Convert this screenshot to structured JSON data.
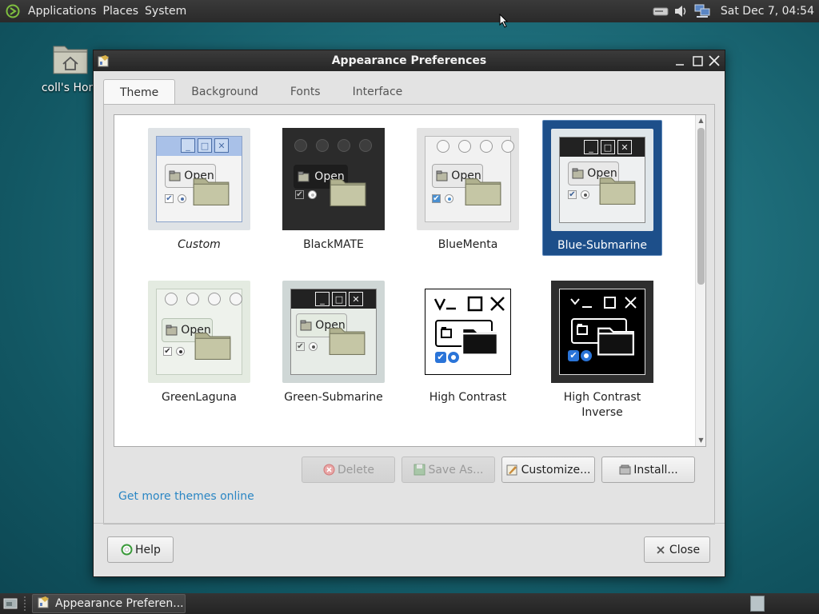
{
  "top_panel": {
    "menus": [
      "Applications",
      "Places",
      "System"
    ],
    "clock": "Sat Dec 7, 04:54"
  },
  "desktop": {
    "home_label": "coll's Hom"
  },
  "window": {
    "title": "Appearance Preferences",
    "tabs": [
      "Theme",
      "Background",
      "Fonts",
      "Interface"
    ],
    "active_tab": "Theme",
    "themes": [
      {
        "name": "Custom",
        "style": "custom",
        "selected": false
      },
      {
        "name": "BlackMATE",
        "style": "blackmate",
        "selected": false
      },
      {
        "name": "BlueMenta",
        "style": "bluementa",
        "selected": false
      },
      {
        "name": "Blue-Submarine",
        "style": "bluesub",
        "selected": true
      },
      {
        "name": "GreenLaguna",
        "style": "greenlaguna",
        "selected": false
      },
      {
        "name": "Green-Submarine",
        "style": "greensub",
        "selected": false
      },
      {
        "name": "High Contrast",
        "style": "hc",
        "selected": false
      },
      {
        "name": "High Contrast Inverse",
        "style": "hci",
        "selected": false
      }
    ],
    "preview_open_label": "Open",
    "buttons": {
      "delete": "Delete",
      "save_as": "Save As...",
      "customize": "Customize...",
      "install": "Install..."
    },
    "more_themes_link": "Get more themes online",
    "help": "Help",
    "close": "Close"
  },
  "taskbar": {
    "window_button": "Appearance Preferen..."
  }
}
